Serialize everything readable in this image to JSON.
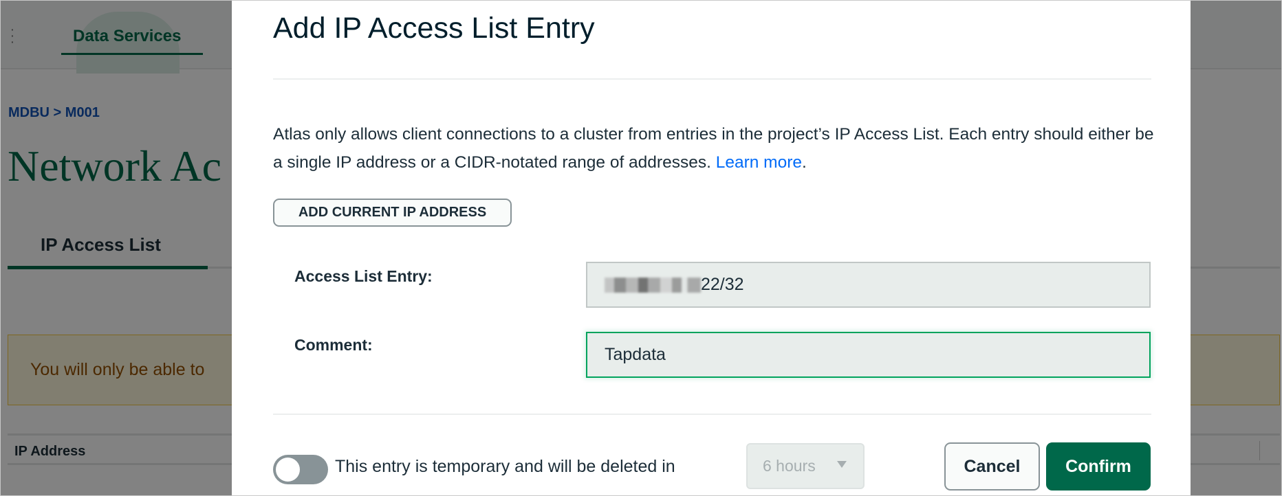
{
  "background": {
    "menu_icon": "vertical-dots-icon",
    "nav_tab": "Data Services",
    "breadcrumb": "MDBU > M001",
    "page_title": "Network Ac",
    "tab": "IP Access List",
    "warning_text": "You will only be able to",
    "table_header": "IP Address"
  },
  "modal": {
    "title": "Add IP Access List Entry",
    "description": "Atlas only allows client connections to a cluster from entries in the project’s IP Access List. Each entry should either be a single IP address or a CIDR-notated range of addresses.",
    "learn_more": "Learn more",
    "period": ".",
    "add_current_ip": "ADD CURRENT IP ADDRESS",
    "entry_label": "Access List Entry:",
    "entry_value_visible": "22/32",
    "comment_label": "Comment:",
    "comment_value": "Tapdata",
    "temporary_text": "This entry is temporary and will be deleted in",
    "temporary_enabled": false,
    "duration_selected": "6 hours",
    "cancel": "Cancel",
    "confirm": "Confirm"
  },
  "colors": {
    "brand_green": "#00684a",
    "link_blue": "#016bf8",
    "focus_green": "#00a35c"
  }
}
